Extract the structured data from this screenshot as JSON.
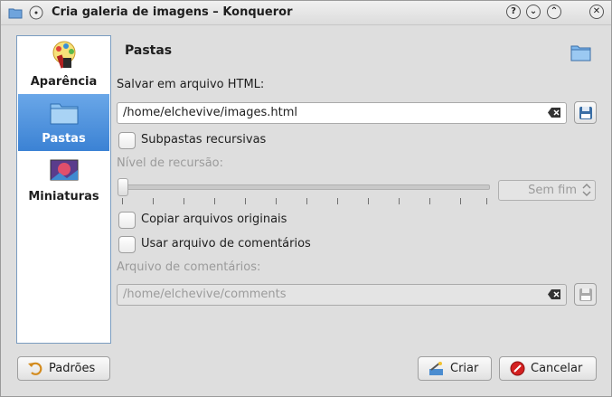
{
  "window": {
    "title": "Cria galeria de imagens – Konqueror",
    "help_btn": "?",
    "minimize_btn": "⌄",
    "maximize_btn": "⌃",
    "close_btn": "✕"
  },
  "sidebar": {
    "items": [
      {
        "label": "Aparência",
        "active": false
      },
      {
        "label": "Pastas",
        "active": true
      },
      {
        "label": "Miniaturas",
        "active": false
      }
    ]
  },
  "page": {
    "title": "Pastas",
    "html_label": "Salvar em arquivo HTML:",
    "html_path": "/home/elchevive/images.html",
    "recursive_label": "Subpastas recursivas",
    "recursion_level_label": "Nível de recursão:",
    "recursion_value": "Sem fim",
    "copy_originals_label": "Copiar arquivos originais",
    "use_comments_label": "Usar arquivo de comentários",
    "comments_label": "Arquivo de comentários:",
    "comments_path": "/home/elchevive/comments"
  },
  "buttons": {
    "defaults": "Padrões",
    "create": "Criar",
    "cancel": "Cancelar"
  }
}
